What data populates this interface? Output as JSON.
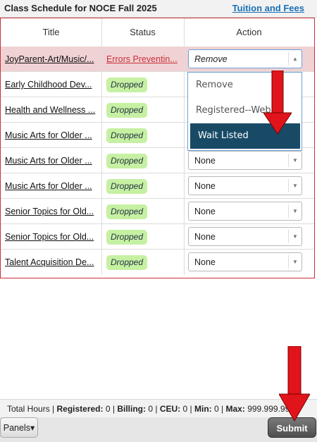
{
  "header": {
    "title": "Class Schedule for NOCE Fall 2025",
    "link": "Tuition and Fees"
  },
  "columns": {
    "title": "Title",
    "status": "Status",
    "action": "Action"
  },
  "rows": [
    {
      "title": "JoyParent-Art/Music/...",
      "status": "Errors Preventin...",
      "action": "Remove"
    },
    {
      "title": "Early Childhood Dev...",
      "status": "Dropped",
      "action": ""
    },
    {
      "title": "Health and Wellness ...",
      "status": "Dropped",
      "action": ""
    },
    {
      "title": "Music Arts for Older ...",
      "status": "Dropped",
      "action": ""
    },
    {
      "title": "Music Arts for Older ...",
      "status": "Dropped",
      "action": "None"
    },
    {
      "title": "Music Arts for Older ...",
      "status": "Dropped",
      "action": "None"
    },
    {
      "title": "Senior Topics for Old...",
      "status": "Dropped",
      "action": "None"
    },
    {
      "title": "Senior Topics for Old...",
      "status": "Dropped",
      "action": "None"
    },
    {
      "title": "Talent Acquisition De...",
      "status": "Dropped",
      "action": "None"
    }
  ],
  "dropdown_options": [
    "Remove",
    "Registered--Web",
    "Wait Listed"
  ],
  "dropdown_selected": "Wait Listed",
  "totals": {
    "prefix": "Total Hours | ",
    "registered_label": "Registered:",
    "registered": "0",
    "billing_label": "Billing:",
    "billing": "0",
    "ceu_label": "CEU:",
    "ceu": "0",
    "min_label": "Min:",
    "min": "0",
    "max_label": "Max:",
    "max": "999.999.999"
  },
  "footer": {
    "panels": "Panels",
    "submit": "Submit"
  },
  "colors": {
    "error": "#c9303a",
    "badge": "#c6f0a2",
    "selected": "#184a66",
    "arrow": "#e0141a",
    "link": "#1a6fb5"
  }
}
